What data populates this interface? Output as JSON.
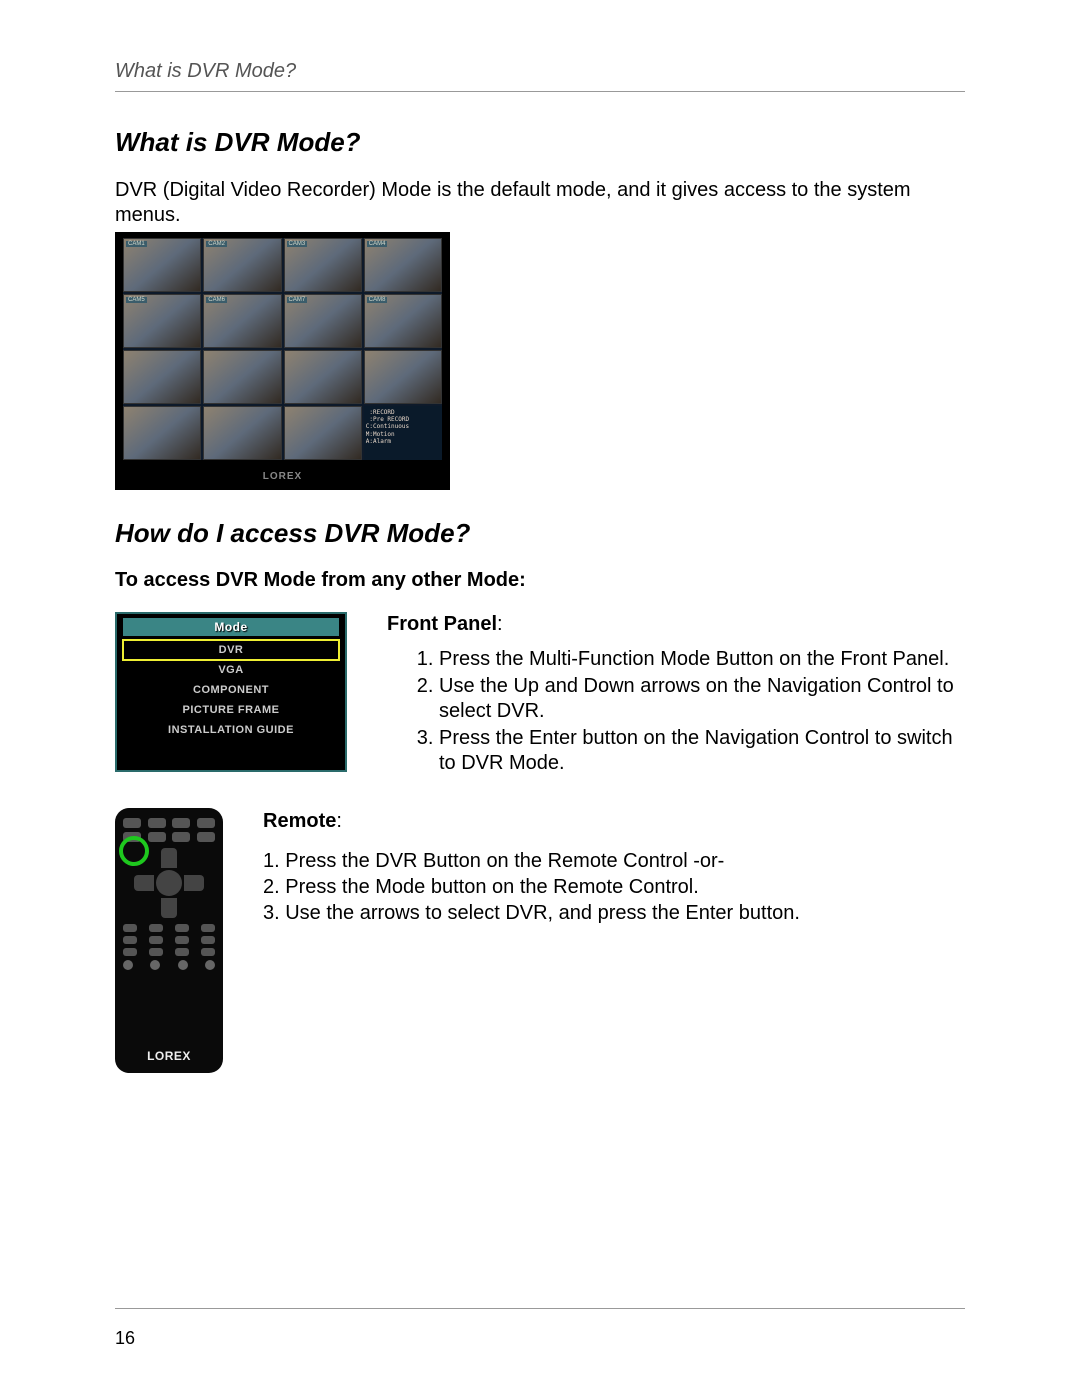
{
  "header": {
    "title": "What is DVR Mode?"
  },
  "section1": {
    "title": "What is DVR Mode?",
    "body": "DVR (Digital Video Recorder) Mode is the default mode, and it gives access to the system menus."
  },
  "monitor": {
    "brand": "LOREX",
    "cam_labels": [
      "CAM1",
      "CAM2",
      "CAM3",
      "CAM4",
      "CAM5",
      "CAM6",
      "CAM7",
      "CAM8"
    ],
    "status": " :RECORD\n :Pre RECORD\nC:Continuous\nM:Motion\nA:Alarm"
  },
  "section2": {
    "title": "How do I access DVR Mode?",
    "subheading": "To access DVR Mode from any other Mode:"
  },
  "mode_menu": {
    "title": "Mode",
    "items": [
      "DVR",
      "VGA",
      "COMPONENT",
      "PICTURE FRAME",
      "INSTALLATION GUIDE"
    ],
    "selected_index": 0
  },
  "front_panel": {
    "label": "Front Panel",
    "colon": ":",
    "steps": [
      "Press the Multi-Function Mode Button on the Front Panel.",
      "Use the Up and Down arrows on the Navigation Control to select DVR.",
      "Press the Enter button on the Navigation Control to switch to DVR Mode."
    ]
  },
  "remote": {
    "label": "Remote",
    "colon": ":",
    "brand": "LOREX",
    "steps": [
      "1. Press the DVR Button on the Remote Control -or-",
      "2. Press the Mode button on the Remote Control.",
      "3. Use the arrows to select DVR, and press the Enter button."
    ]
  },
  "page_number": "16"
}
